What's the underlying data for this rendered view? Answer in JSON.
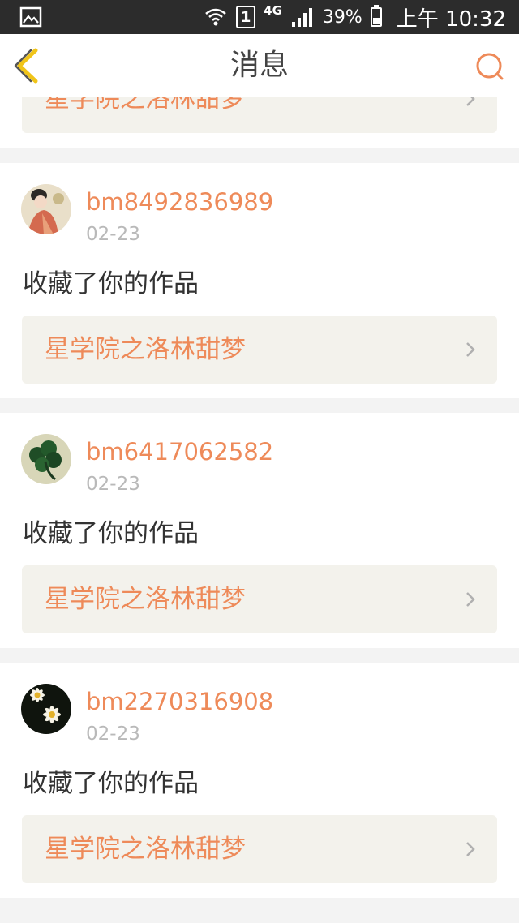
{
  "status_bar": {
    "battery_percent": "39%",
    "network_type": "4G",
    "sim_slot": "1",
    "time": "上午 10:32",
    "icons": [
      "gallery-icon",
      "wifi-icon",
      "sim-icon",
      "signal-icon",
      "battery-icon"
    ]
  },
  "header": {
    "title": "消息",
    "back_icon": "chevron-left-icon",
    "search_icon": "search-icon",
    "accent_color": "#ee8a59"
  },
  "partial_card": {
    "work_title": "星学院之洛林甜梦"
  },
  "messages": [
    {
      "username": "bm8492836989",
      "date": "02-23",
      "action": "收藏了你的作品",
      "work_title": "星学院之洛林甜梦",
      "avatar": "avatar-woman-portrait"
    },
    {
      "username": "bm6417062582",
      "date": "02-23",
      "action": "收藏了你的作品",
      "work_title": "星学院之洛林甜梦",
      "avatar": "avatar-clover"
    },
    {
      "username": "bm2270316908",
      "date": "02-23",
      "action": "收藏了你的作品",
      "work_title": "星学院之洛林甜梦",
      "avatar": "avatar-daisies"
    }
  ]
}
